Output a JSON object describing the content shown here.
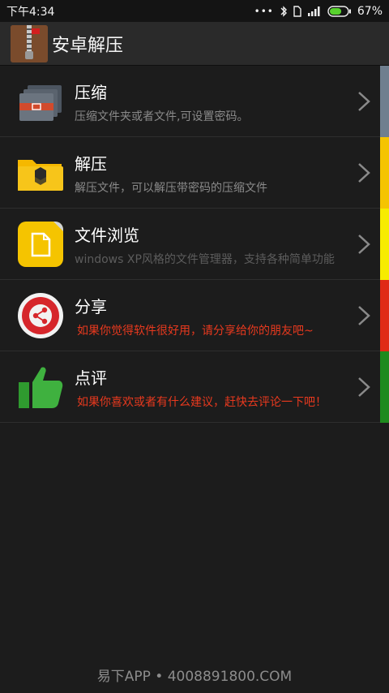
{
  "status_bar": {
    "time": "下午4:34",
    "battery_percent": "67%",
    "battery_level": 0.67
  },
  "app_bar": {
    "title": "安卓解压"
  },
  "menu": [
    {
      "title": "压缩",
      "subtitle": "压缩文件夹或者文件,可设置密码。",
      "icon": "archive-box-icon",
      "stripe_color": "#6f7f8f",
      "subtitle_color": "#8a8a8a"
    },
    {
      "title": "解压",
      "subtitle": "解压文件，可以解压带密码的压缩文件",
      "icon": "open-folder-icon",
      "stripe_color": "#f5c400",
      "subtitle_color": "#8a8a8a"
    },
    {
      "title": "文件浏览",
      "subtitle": "windows XP风格的文件管理器，支持各种简单功能",
      "icon": "file-browser-icon",
      "stripe_color": "#f7ec00",
      "subtitle_color": "#5c5c5c"
    },
    {
      "title": "分享",
      "subtitle": "如果你觉得软件很好用，请分享给你的朋友吧~",
      "icon": "share-icon",
      "stripe_color": "#e02a16",
      "subtitle_color": "#e8391e"
    },
    {
      "title": "点评",
      "subtitle": "如果你喜欢或者有什么建议，赶快去评论一下吧！",
      "icon": "thumbs-up-icon",
      "stripe_color": "#1e8a1e",
      "subtitle_color": "#e8391e"
    }
  ],
  "footer": {
    "text": "易下APP • 4008891800.COM"
  }
}
